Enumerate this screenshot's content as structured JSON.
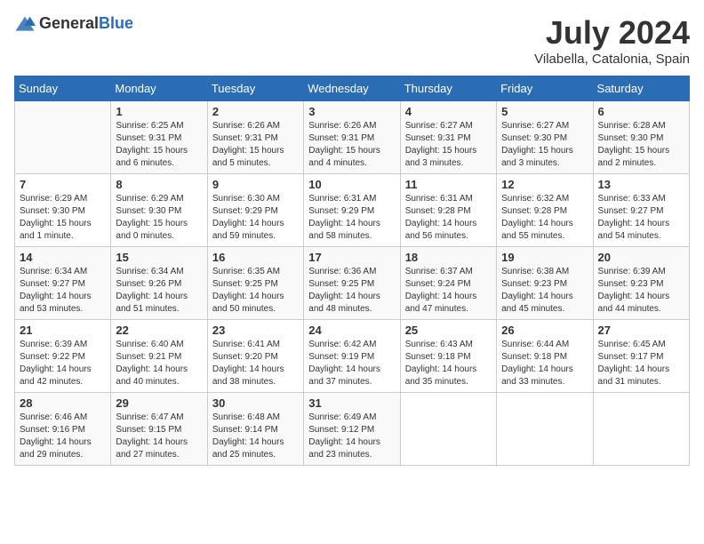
{
  "header": {
    "logo_general": "General",
    "logo_blue": "Blue",
    "month_year": "July 2024",
    "location": "Vilabella, Catalonia, Spain"
  },
  "weekdays": [
    "Sunday",
    "Monday",
    "Tuesday",
    "Wednesday",
    "Thursday",
    "Friday",
    "Saturday"
  ],
  "weeks": [
    [
      {
        "day": "",
        "sunrise": "",
        "sunset": "",
        "daylight": ""
      },
      {
        "day": "1",
        "sunrise": "6:25 AM",
        "sunset": "9:31 PM",
        "daylight": "15 hours and 6 minutes."
      },
      {
        "day": "2",
        "sunrise": "6:26 AM",
        "sunset": "9:31 PM",
        "daylight": "15 hours and 5 minutes."
      },
      {
        "day": "3",
        "sunrise": "6:26 AM",
        "sunset": "9:31 PM",
        "daylight": "15 hours and 4 minutes."
      },
      {
        "day": "4",
        "sunrise": "6:27 AM",
        "sunset": "9:31 PM",
        "daylight": "15 hours and 3 minutes."
      },
      {
        "day": "5",
        "sunrise": "6:27 AM",
        "sunset": "9:30 PM",
        "daylight": "15 hours and 3 minutes."
      },
      {
        "day": "6",
        "sunrise": "6:28 AM",
        "sunset": "9:30 PM",
        "daylight": "15 hours and 2 minutes."
      }
    ],
    [
      {
        "day": "7",
        "sunrise": "6:29 AM",
        "sunset": "9:30 PM",
        "daylight": "15 hours and 1 minute."
      },
      {
        "day": "8",
        "sunrise": "6:29 AM",
        "sunset": "9:30 PM",
        "daylight": "15 hours and 0 minutes."
      },
      {
        "day": "9",
        "sunrise": "6:30 AM",
        "sunset": "9:29 PM",
        "daylight": "14 hours and 59 minutes."
      },
      {
        "day": "10",
        "sunrise": "6:31 AM",
        "sunset": "9:29 PM",
        "daylight": "14 hours and 58 minutes."
      },
      {
        "day": "11",
        "sunrise": "6:31 AM",
        "sunset": "9:28 PM",
        "daylight": "14 hours and 56 minutes."
      },
      {
        "day": "12",
        "sunrise": "6:32 AM",
        "sunset": "9:28 PM",
        "daylight": "14 hours and 55 minutes."
      },
      {
        "day": "13",
        "sunrise": "6:33 AM",
        "sunset": "9:27 PM",
        "daylight": "14 hours and 54 minutes."
      }
    ],
    [
      {
        "day": "14",
        "sunrise": "6:34 AM",
        "sunset": "9:27 PM",
        "daylight": "14 hours and 53 minutes."
      },
      {
        "day": "15",
        "sunrise": "6:34 AM",
        "sunset": "9:26 PM",
        "daylight": "14 hours and 51 minutes."
      },
      {
        "day": "16",
        "sunrise": "6:35 AM",
        "sunset": "9:25 PM",
        "daylight": "14 hours and 50 minutes."
      },
      {
        "day": "17",
        "sunrise": "6:36 AM",
        "sunset": "9:25 PM",
        "daylight": "14 hours and 48 minutes."
      },
      {
        "day": "18",
        "sunrise": "6:37 AM",
        "sunset": "9:24 PM",
        "daylight": "14 hours and 47 minutes."
      },
      {
        "day": "19",
        "sunrise": "6:38 AM",
        "sunset": "9:23 PM",
        "daylight": "14 hours and 45 minutes."
      },
      {
        "day": "20",
        "sunrise": "6:39 AM",
        "sunset": "9:23 PM",
        "daylight": "14 hours and 44 minutes."
      }
    ],
    [
      {
        "day": "21",
        "sunrise": "6:39 AM",
        "sunset": "9:22 PM",
        "daylight": "14 hours and 42 minutes."
      },
      {
        "day": "22",
        "sunrise": "6:40 AM",
        "sunset": "9:21 PM",
        "daylight": "14 hours and 40 minutes."
      },
      {
        "day": "23",
        "sunrise": "6:41 AM",
        "sunset": "9:20 PM",
        "daylight": "14 hours and 38 minutes."
      },
      {
        "day": "24",
        "sunrise": "6:42 AM",
        "sunset": "9:19 PM",
        "daylight": "14 hours and 37 minutes."
      },
      {
        "day": "25",
        "sunrise": "6:43 AM",
        "sunset": "9:18 PM",
        "daylight": "14 hours and 35 minutes."
      },
      {
        "day": "26",
        "sunrise": "6:44 AM",
        "sunset": "9:18 PM",
        "daylight": "14 hours and 33 minutes."
      },
      {
        "day": "27",
        "sunrise": "6:45 AM",
        "sunset": "9:17 PM",
        "daylight": "14 hours and 31 minutes."
      }
    ],
    [
      {
        "day": "28",
        "sunrise": "6:46 AM",
        "sunset": "9:16 PM",
        "daylight": "14 hours and 29 minutes."
      },
      {
        "day": "29",
        "sunrise": "6:47 AM",
        "sunset": "9:15 PM",
        "daylight": "14 hours and 27 minutes."
      },
      {
        "day": "30",
        "sunrise": "6:48 AM",
        "sunset": "9:14 PM",
        "daylight": "14 hours and 25 minutes."
      },
      {
        "day": "31",
        "sunrise": "6:49 AM",
        "sunset": "9:12 PM",
        "daylight": "14 hours and 23 minutes."
      },
      {
        "day": "",
        "sunrise": "",
        "sunset": "",
        "daylight": ""
      },
      {
        "day": "",
        "sunrise": "",
        "sunset": "",
        "daylight": ""
      },
      {
        "day": "",
        "sunrise": "",
        "sunset": "",
        "daylight": ""
      }
    ]
  ],
  "labels": {
    "sunrise": "Sunrise:",
    "sunset": "Sunset:",
    "daylight": "Daylight:"
  }
}
